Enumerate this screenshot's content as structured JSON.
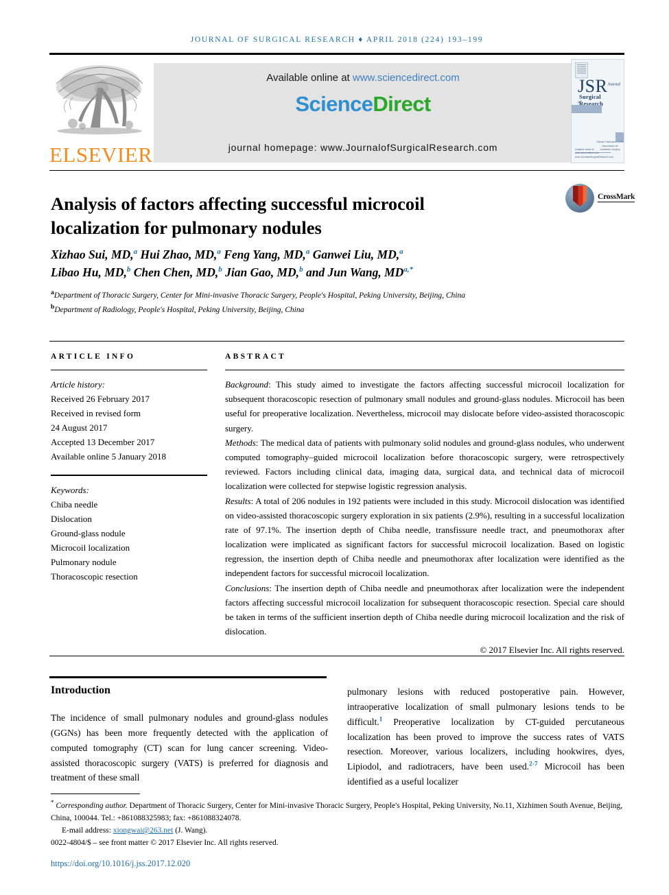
{
  "running_head": "JOURNAL OF SURGICAL RESEARCH ♦ APRIL 2018 (224) 193–199",
  "masthead": {
    "publisher_logo_text": "ELSEVIER",
    "available_prefix": "Available online at ",
    "available_url": "www.sciencedirect.com",
    "sciencedirect_part1": "Science",
    "sciencedirect_part2": "Direct",
    "journal_homepage": "journal homepage: www.JournalofSurgicalResearch.com",
    "cover": {
      "acronym": "JSR",
      "acronym_superscript": "Journal of",
      "subtitle": "Surgical Research",
      "note": "Official Publication of the Association for Academic Surgery",
      "foot": "Available online at www.sciencedirect.com www.JournalofSurgicalResearch.com"
    }
  },
  "article": {
    "title": "Analysis of factors affecting successful microcoil localization for pulmonary nodules",
    "crossmark_label": "CrossMark",
    "authors_line1": "Xizhao Sui, MD,<sup>a</sup> Hui Zhao, MD,<sup>a</sup> Feng Yang, MD,<sup>a</sup> Ganwei Liu, MD,<sup>a</sup>",
    "authors_line2": "Libao Hu, MD,<sup>b</sup> Chen Chen, MD,<sup>b</sup> Jian Gao, MD,<sup>b</sup> and Jun Wang, MD<sup>a,*</sup>",
    "affiliation_a": "<sup>a</sup>Department of Thoracic Surgery, Center for Mini-invasive Thoracic Surgery, People's Hospital, Peking University, Beijing, China",
    "affiliation_b": "<sup>b</sup>Department of Radiology, People's Hospital, Peking University, Beijing, China"
  },
  "article_info": {
    "heading": "ARTICLE INFO",
    "history_label": "Article history:",
    "history": [
      "Received 26 February 2017",
      "Received in revised form",
      "24 August 2017",
      "Accepted 13 December 2017",
      "Available online 5 January 2018"
    ],
    "keywords_label": "Keywords:",
    "keywords": [
      "Chiba needle",
      "Dislocation",
      "Ground-glass nodule",
      "Microcoil localization",
      "Pulmonary nodule",
      "Thoracoscopic resection"
    ]
  },
  "abstract": {
    "heading": "ABSTRACT",
    "sections": [
      {
        "label": "Background",
        "text": "This study aimed to investigate the factors affecting successful microcoil localization for subsequent thoracoscopic resection of pulmonary small nodules and ground-glass nodules. Microcoil has been useful for preoperative localization. Nevertheless, microcoil may dislocate before video-assisted thoracoscopic surgery."
      },
      {
        "label": "Methods",
        "text": "The medical data of patients with pulmonary solid nodules and ground-glass nodules, who underwent computed tomography–guided microcoil localization before thoracoscopic surgery, were retrospectively reviewed. Factors including clinical data, imaging data, surgical data, and technical data of microcoil localization were collected for stepwise logistic regression analysis."
      },
      {
        "label": "Results",
        "text": "A total of 206 nodules in 192 patients were included in this study. Microcoil dislocation was identified on video-assisted thoracoscopic surgery exploration in six patients (2.9%), resulting in a successful localization rate of 97.1%. The insertion depth of Chiba needle, transfissure needle tract, and pneumothorax after localization were implicated as significant factors for successful microcoil localization. Based on logistic regression, the insertion depth of Chiba needle and pneumothorax after localization were identified as the independent factors for successful microcoil localization."
      },
      {
        "label": "Conclusions",
        "text": "The insertion depth of Chiba needle and pneumothorax after localization were the independent factors affecting successful microcoil localization for subsequent thoracoscopic resection. Special care should be taken in terms of the sufficient insertion depth of Chiba needle during microcoil localization and the risk of dislocation."
      }
    ],
    "copyright": "© 2017 Elsevier Inc. All rights reserved."
  },
  "body": {
    "section_heading": "Introduction",
    "left_column": "The incidence of small pulmonary nodules and ground-glass nodules (GGNs) has been more frequently detected with the application of computed tomography (CT) scan for lung cancer screening. Video-assisted thoracoscopic surgery (VATS) is preferred for diagnosis and treatment of these small",
    "right_column": "pulmonary lesions with reduced postoperative pain. However, intraoperative localization of small pulmonary lesions tends to be difficult.<sup>1</sup> Preoperative localization by CT-guided percutaneous localization has been proved to improve the success rates of VATS resection. Moreover, various localizers, including hookwires, dyes, Lipiodol, and radiotracers, have been used.<sup>2-7</sup> Microcoil has been identified as a useful localizer"
  },
  "footer": {
    "corresponding_marker": "*",
    "corresponding_label": "Corresponding author.",
    "corresponding_text": " Department of Thoracic Surgery, Center for Mini-invasive Thoracic Surgery, People's Hospital, Peking University, No.11, Xizhimen South Avenue, Beijing, China, 100044. Tel.: +861088325983; fax: +861088324078.",
    "email_label": "E-mail address: ",
    "email": "xiongwai@263.net",
    "email_suffix": " (J. Wang).",
    "issn_line": "0022-4804/$ – see front matter © 2017 Elsevier Inc. All rights reserved.",
    "doi": "https://doi.org/10.1016/j.jss.2017.12.020"
  },
  "colors": {
    "accent_blue": "#1b6ea8",
    "elsevier_orange": "#F08C1F",
    "sciencedirect_green": "#2aa728",
    "sciencedirect_blue": "#2f8fd0",
    "banner_gray": "#e3e3e3"
  }
}
